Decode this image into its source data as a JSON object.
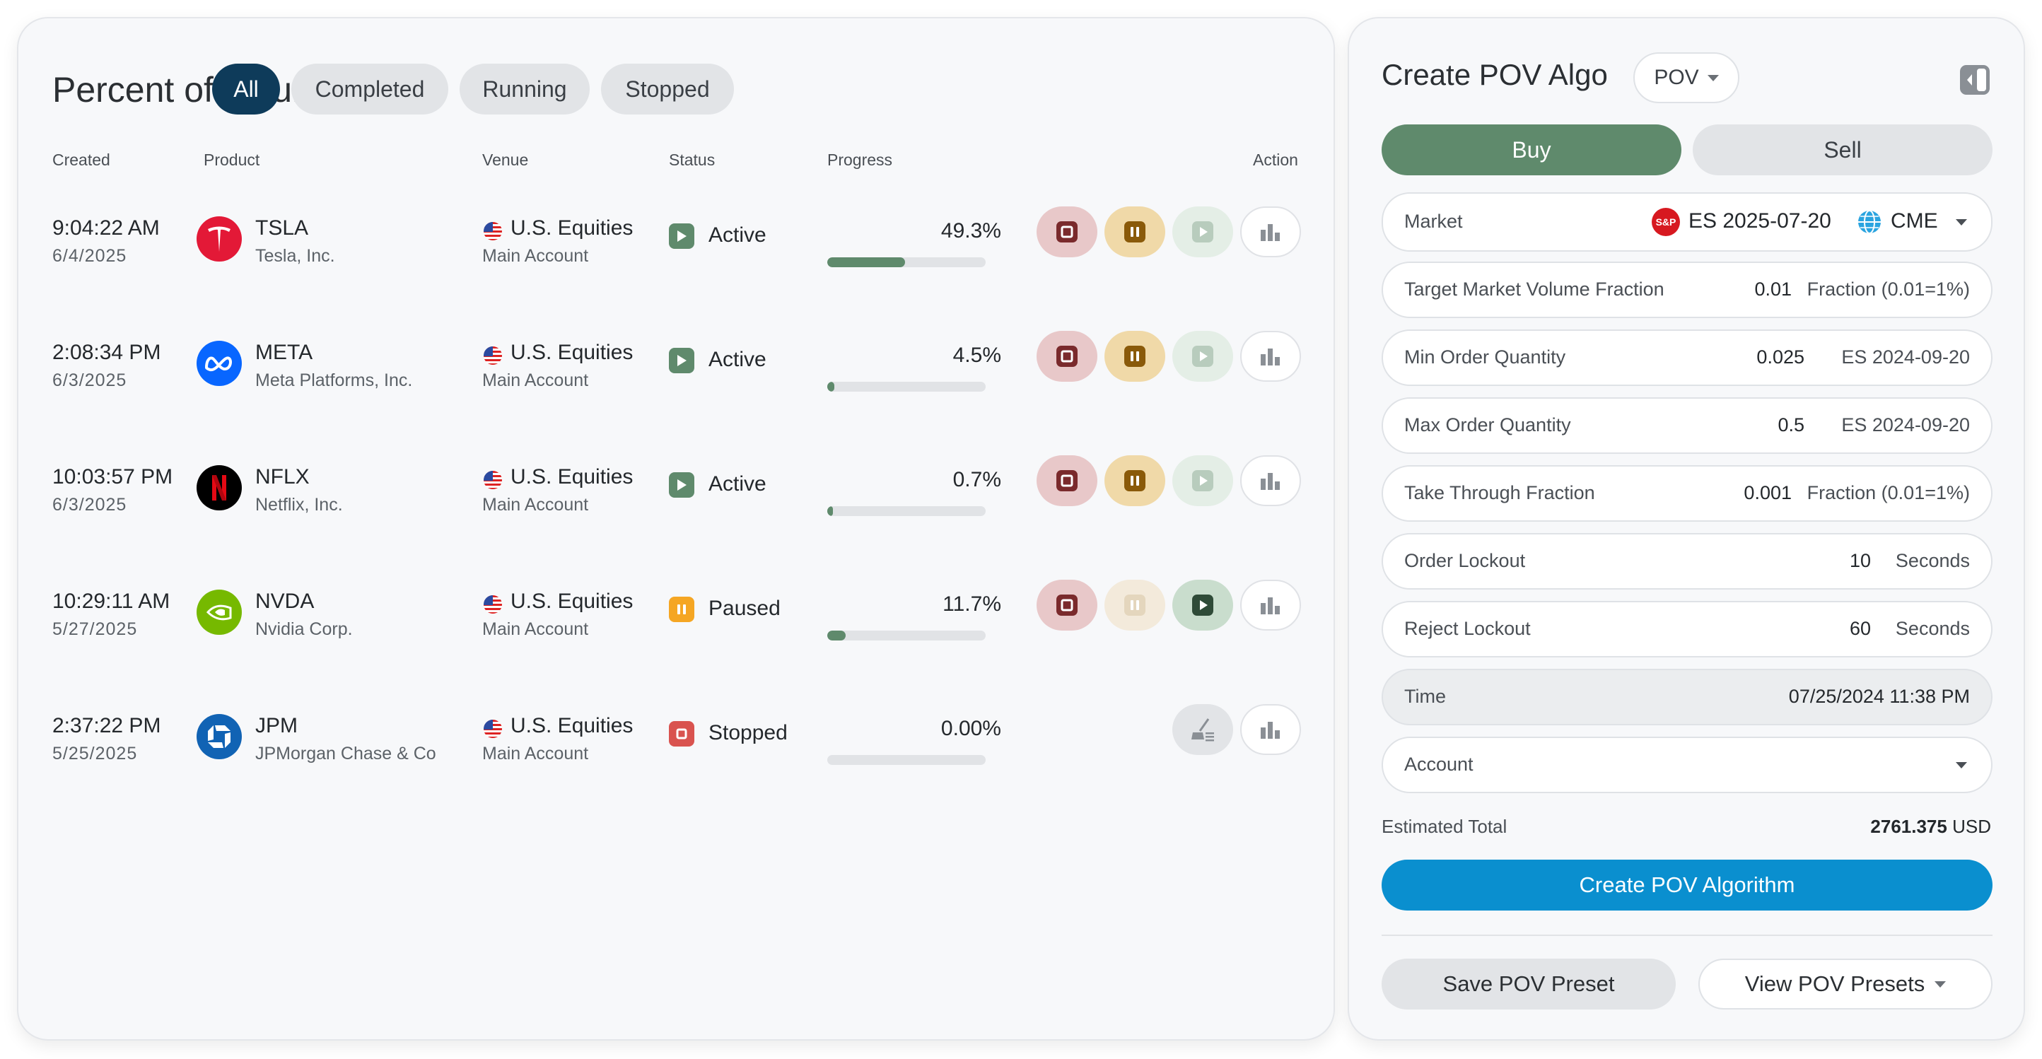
{
  "left": {
    "title": "Percent of Volume",
    "filters": [
      "All",
      "Completed",
      "Running",
      "Stopped"
    ],
    "active_filter": "All",
    "columns": {
      "created": "Created",
      "product": "Product",
      "venue": "Venue",
      "status": "Status",
      "progress": "Progress",
      "action": "Action"
    },
    "rows": [
      {
        "time": "9:04:22 AM",
        "date": "6/4/2025",
        "ticker": "TSLA",
        "company": "Tesla, Inc.",
        "logo": "tesla-logo",
        "logo_color": "#e31937",
        "venue": "U.S. Equities",
        "account": "Main Account",
        "status": "Active",
        "progress_text": "49.3%",
        "progress": 0.493
      },
      {
        "time": "2:08:34 PM",
        "date": "6/3/2025",
        "ticker": "META",
        "company": "Meta Platforms, Inc.",
        "logo": "meta-logo",
        "logo_color": "#0866ff",
        "venue": "U.S. Equities",
        "account": "Main Account",
        "status": "Active",
        "progress_text": "4.5%",
        "progress": 0.045
      },
      {
        "time": "10:03:57 PM",
        "date": "6/3/2025",
        "ticker": "NFLX",
        "company": "Netflix, Inc.",
        "logo": "netflix-logo",
        "logo_color": "#000000",
        "venue": "U.S. Equities",
        "account": "Main Account",
        "status": "Active",
        "progress_text": "0.7%",
        "progress": 0.007
      },
      {
        "time": "10:29:11 AM",
        "date": "5/27/2025",
        "ticker": "NVDA",
        "company": "Nvidia Corp.",
        "logo": "nvidia-logo",
        "logo_color": "#76b900",
        "venue": "U.S. Equities",
        "account": "Main Account",
        "status": "Paused",
        "progress_text": "11.7%",
        "progress": 0.117
      },
      {
        "time": "2:37:22 PM",
        "date": "5/25/2025",
        "ticker": "JPM",
        "company": "JPMorgan Chase & Co",
        "logo": "jpm-logo",
        "logo_color": "#1163b4",
        "venue": "U.S. Equities",
        "account": "Main Account",
        "status": "Stopped",
        "progress_text": "0.00%",
        "progress": 0.0
      }
    ],
    "colors": {
      "active": "#5f8a6c",
      "paused": "#f5a623",
      "stopped": "#d9534f",
      "stop_icon": "#7a2a2c",
      "pause_icon": "#8a5a0a"
    }
  },
  "right": {
    "title": "Create POV Algo",
    "algo_type": "POV",
    "buy_label": "Buy",
    "sell_label": "Sell",
    "market": {
      "label": "Market",
      "symbol": "ES 2025-07-20",
      "symbol_badge": "S&P",
      "exchange": "CME"
    },
    "fields": [
      {
        "label": "Target Market Volume Fraction",
        "value": "0.01",
        "unit": "Fraction (0.01=1%)"
      },
      {
        "label": "Min Order Quantity",
        "value": "0.025",
        "unit": "ES 2024-09-20"
      },
      {
        "label": "Max Order Quantity",
        "value": "0.5",
        "unit": "ES 2024-09-20"
      },
      {
        "label": "Take Through Fraction",
        "value": "0.001",
        "unit": "Fraction (0.01=1%)"
      },
      {
        "label": "Order Lockout",
        "value": "10",
        "unit": "Seconds"
      },
      {
        "label": "Reject Lockout",
        "value": "60",
        "unit": "Seconds"
      }
    ],
    "time": {
      "label": "Time",
      "value": "07/25/2024 11:38 PM"
    },
    "account": {
      "label": "Account"
    },
    "estimated_total": {
      "label": "Estimated Total",
      "value": "2761.375",
      "currency": "USD"
    },
    "create_button": "Create POV Algorithm",
    "save_preset": "Save POV Preset",
    "view_presets": "View POV Presets",
    "colors": {
      "buy": "#5f8a6c",
      "create": "#0a8fcf"
    }
  }
}
